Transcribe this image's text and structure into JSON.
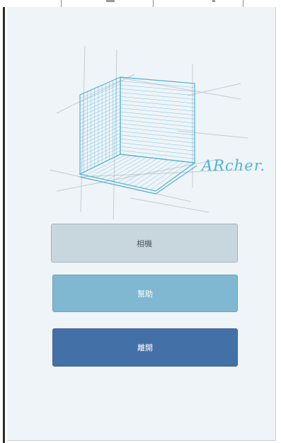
{
  "logo": {
    "wordmark": "ARcher.",
    "line_color": "#4fb3d6",
    "guide_color": "#c3ccd3"
  },
  "buttons": {
    "camera": {
      "label": "相機",
      "bg": "#c8d6de"
    },
    "help": {
      "label": "幫助",
      "bg": "#7fb8d0"
    },
    "exit": {
      "label": "離開",
      "bg": "#4470a8"
    }
  }
}
